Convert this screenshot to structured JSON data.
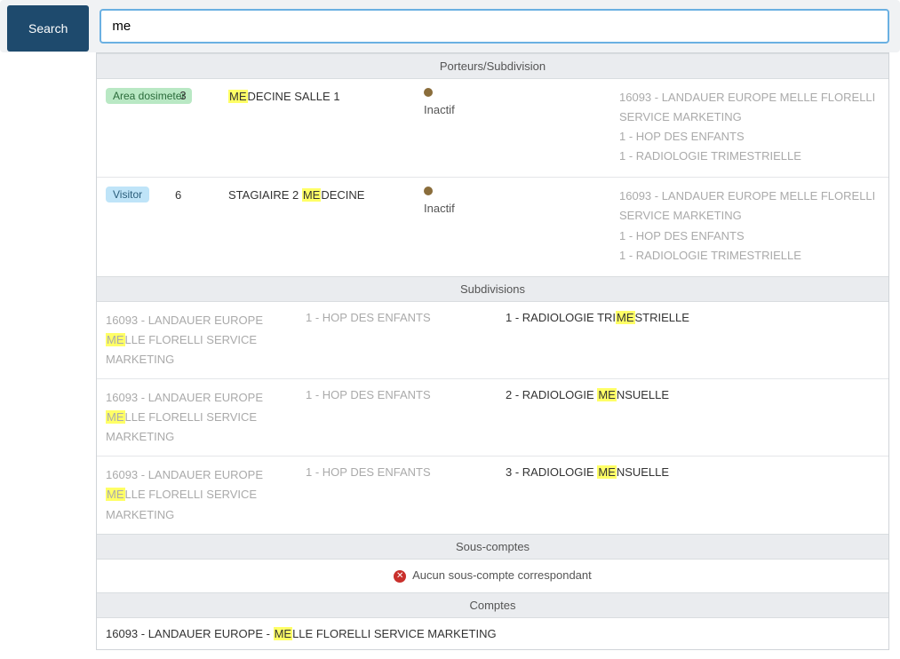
{
  "search": {
    "button_label": "Search",
    "value": "me"
  },
  "sections": {
    "porteurs_header": "Porteurs/Subdivision",
    "subdivisions_header": "Subdivisions",
    "sous_comptes_header": "Sous-comptes",
    "comptes_header": "Comptes"
  },
  "porteurs": [
    {
      "badge_type": "green",
      "badge_label": "Area dosimeter",
      "number": "3",
      "name_pre": "",
      "name_hl": "ME",
      "name_post": "DECINE SALLE 1",
      "status": "Inactif",
      "path": [
        "16093 - LANDAUER EUROPE MELLE FLORELLI SERVICE MARKETING",
        "1 - HOP DES ENFANTS",
        "1 - RADIOLOGIE TRIMESTRIELLE"
      ]
    },
    {
      "badge_type": "blue",
      "badge_label": "Visitor",
      "number": "6",
      "name_pre": "STAGIAIRE 2 ",
      "name_hl": "ME",
      "name_post": "DECINE",
      "status": "Inactif",
      "path": [
        "16093 - LANDAUER EUROPE MELLE FLORELLI SERVICE MARKETING",
        "1 - HOP DES ENFANTS",
        "1 - RADIOLOGIE TRIMESTRIELLE"
      ]
    }
  ],
  "subdivisions": [
    {
      "col1_pre": "16093 - LANDAUER EUROPE ",
      "col1_hl": "ME",
      "col1_post": "LLE FLORELLI SERVICE MARKETING",
      "col2": "1 - HOP DES ENFANTS",
      "col3_pre": "1 - RADIOLOGIE TRI",
      "col3_hl": "ME",
      "col3_post": "STRIELLE"
    },
    {
      "col1_pre": "16093 - LANDAUER EUROPE ",
      "col1_hl": "ME",
      "col1_post": "LLE FLORELLI SERVICE MARKETING",
      "col2": "1 - HOP DES ENFANTS",
      "col3_pre": "2 - RADIOLOGIE ",
      "col3_hl": "ME",
      "col3_post": "NSUELLE"
    },
    {
      "col1_pre": "16093 - LANDAUER EUROPE ",
      "col1_hl": "ME",
      "col1_post": "LLE FLORELLI SERVICE MARKETING",
      "col2": "1 - HOP DES ENFANTS",
      "col3_pre": "3 - RADIOLOGIE ",
      "col3_hl": "ME",
      "col3_post": "NSUELLE"
    }
  ],
  "sous_comptes_empty": "Aucun sous-compte correspondant",
  "comptes": [
    {
      "pre": "16093 - LANDAUER EUROPE - ",
      "hl": "ME",
      "post": "LLE FLORELLI SERVICE MARKETING"
    }
  ]
}
